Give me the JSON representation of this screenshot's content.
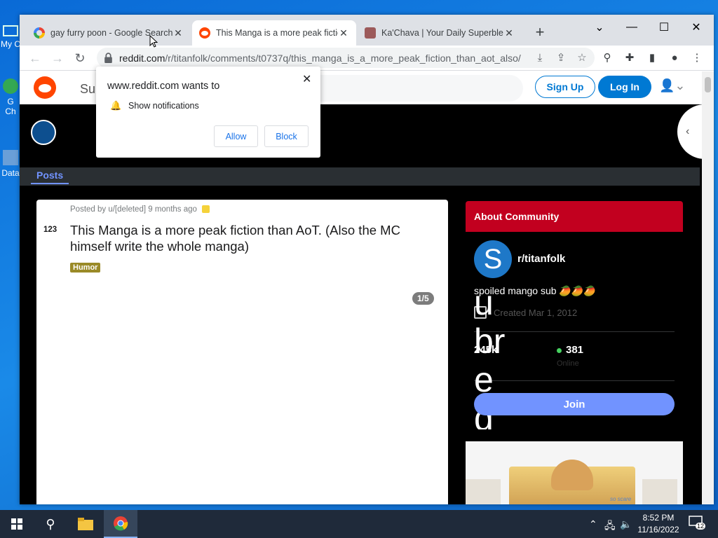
{
  "desktop": {
    "icon1_label": "My C",
    "icon2_label": "G\nCh",
    "icon3_label": "Data"
  },
  "browser": {
    "tabs": [
      {
        "title": "gay furry poon - Google Search",
        "favicon": "google-icon"
      },
      {
        "title": "This Manga is a more peak fiction",
        "favicon": "reddit-icon"
      },
      {
        "title": "Ka'Chava | Your Daily Superblend",
        "favicon": "kachava-icon"
      }
    ],
    "url_host": "reddit.com",
    "url_path": "/r/titanfolk/comments/t0737q/this_manga_is_a_more_peak_fiction_than_aot_also/"
  },
  "notification_prompt": {
    "title": "www.reddit.com wants to",
    "permission": "Show notifications",
    "allow_label": "Allow",
    "block_label": "Block"
  },
  "reddit": {
    "header": {
      "logo_alt": "Su",
      "signup_label": "Sign Up",
      "login_label": "Log In"
    },
    "subnav": {
      "posts_tab": "Posts"
    },
    "post": {
      "meta": "Posted by u/[deleted] 9 months ago",
      "votes": "123",
      "title": "This Manga is a more peak fiction than AoT. (Also the MC himself write the whole manga)",
      "flair": "Humor",
      "gallery_count": "1/5"
    },
    "about": {
      "header": "About Community",
      "avatar_letter": "S",
      "subreddit": "r/titanfolk",
      "description": "spoiled mango sub 🥭🥭🥭",
      "created": "Created Mar 1, 2012",
      "members": "245k",
      "online": "381",
      "online_label": "Online",
      "overlap_text": "u\nbr\ne\nd",
      "join_label": "Join"
    },
    "ad": {
      "text": "so scare"
    }
  },
  "taskbar": {
    "time": "8:52 PM",
    "date": "11/16/2022",
    "notifications": "12"
  }
}
